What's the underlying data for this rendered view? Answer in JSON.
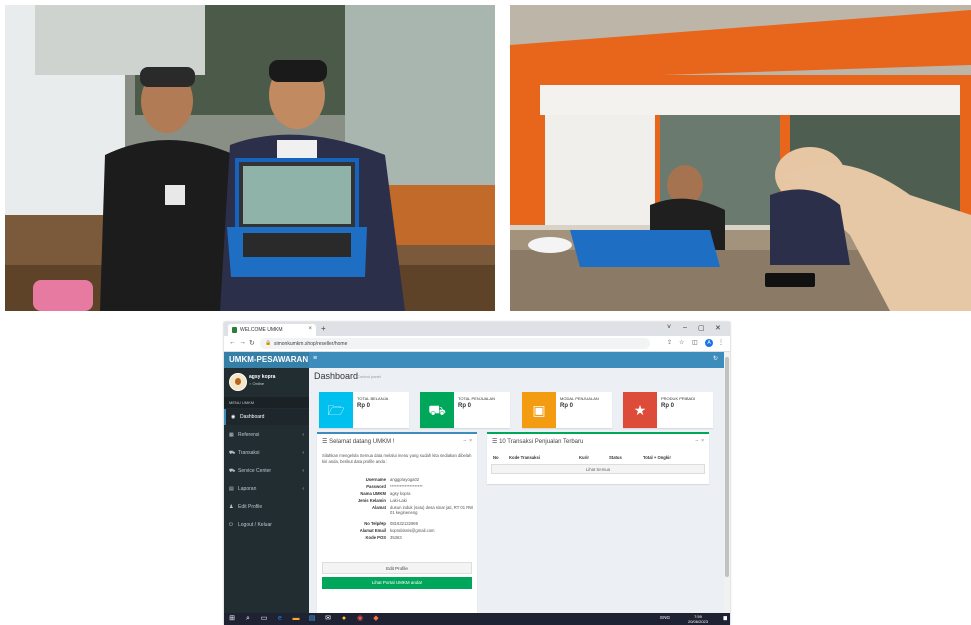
{
  "browser": {
    "tab_title": "WELCOME UMKM",
    "tab_close": "×",
    "new_tab": "+",
    "url": "simonkumkm.shop/reseller/home",
    "window_controls": [
      "˅",
      "–",
      "▢",
      "✕"
    ],
    "profile_initial": "A"
  },
  "app": {
    "brand": "UMKM-PESAWARAN",
    "user": {
      "name": "agsy kopra",
      "status": "Online"
    },
    "menu_header": "MENU UMKM",
    "menu": [
      {
        "label": "Dashboard",
        "icon": "dashboard-icon"
      },
      {
        "label": "Referensi",
        "icon": "th-icon"
      },
      {
        "label": "Transaksi",
        "icon": "cart-icon"
      },
      {
        "label": "Service Center",
        "icon": "cart-icon"
      },
      {
        "label": "Laporan",
        "icon": "book-icon"
      },
      {
        "label": "Edit Profile",
        "icon": "user-icon"
      },
      {
        "label": "Logout / Keluar",
        "icon": "power-icon"
      }
    ],
    "page_title": "Dashboard",
    "page_subtitle": "Control panel",
    "info_boxes": [
      {
        "label": "TOTAL BELANJA",
        "value": "Rp 0",
        "color": "#00c0ef",
        "icon": "folder-open-icon"
      },
      {
        "label": "TOTAL PENJUALAN",
        "value": "Rp 0",
        "color": "#00a65a",
        "icon": "cart-icon"
      },
      {
        "label": "MODAL PENJUALAN",
        "value": "Rp 0",
        "color": "#f39c12",
        "icon": "briefcase-icon"
      },
      {
        "label": "PRODUK PRIBADI",
        "value": "Rp 0",
        "color": "#dd4b39",
        "icon": "star-icon"
      }
    ],
    "welcome": {
      "title": "Selamat datang UMKM !",
      "text": "Silahkan mengelola Semua data melalui menu yang sudah kita sediakan dibelah kiri anda, berikut data profile anda :",
      "fields": [
        {
          "key": "Username",
          "value": "anggprayoga02"
        },
        {
          "key": "Password",
          "value": "********************"
        },
        {
          "key": "Nama UMKM",
          "value": "agsy kopra"
        },
        {
          "key": "Jenis Kelamin",
          "value": "Laki-Laki"
        },
        {
          "key": "Alamat",
          "value": "dusun induk (satu) desa sinar jati, RT 01 RW 01 kegineneng"
        },
        {
          "key": "No Telp/Hp",
          "value": "081632132969"
        },
        {
          "key": "Alamat Email",
          "value": "koprabisnis@gmail.com"
        },
        {
          "key": "Kode POS",
          "value": "35363"
        }
      ],
      "edit_button": "Edit Profile",
      "portal_button": "Lihat Portal UMKM anda!"
    },
    "transactions": {
      "title": "10 Transaksi Penjualan Terbaru",
      "columns": [
        "No",
        "Kode Transaksi",
        "Kurir",
        "Status",
        "Total + Ongkir"
      ],
      "view_all": "Lihat Semua"
    }
  },
  "taskbar": {
    "time": "7:59",
    "date": "20/06/2023",
    "lang": "ENG"
  }
}
